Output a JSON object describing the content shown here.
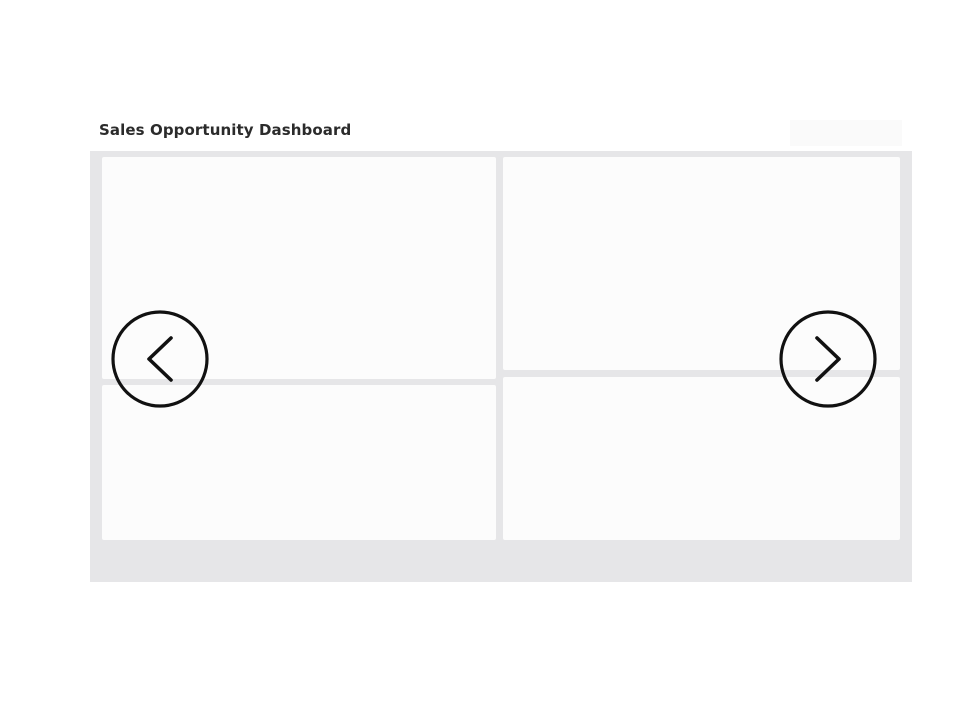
{
  "dashboard": {
    "title": "Sales Opportunity Dashboard"
  },
  "tiles": [
    {
      "name": "tile-top-left"
    },
    {
      "name": "tile-top-right"
    },
    {
      "name": "tile-bottom-left"
    },
    {
      "name": "tile-bottom-right"
    }
  ],
  "navigation": {
    "previous_icon": "chevron-left-circle-icon",
    "next_icon": "chevron-right-circle-icon"
  },
  "colors": {
    "canvas_background": "#e6e6e8",
    "tile_background": "#fcfcfc",
    "title_text": "#2b2b2b",
    "nav_stroke": "#111111"
  }
}
